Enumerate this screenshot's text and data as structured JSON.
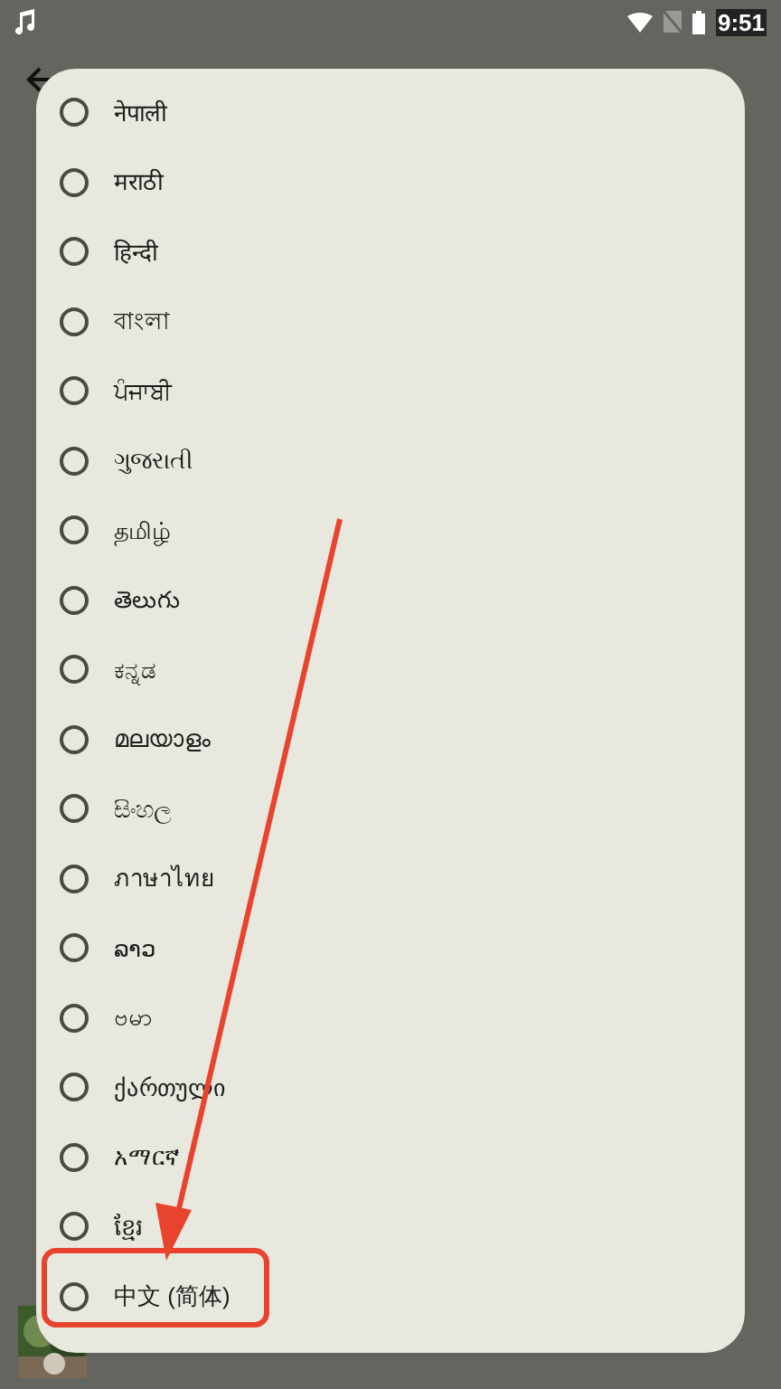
{
  "status_bar": {
    "time": "9:51"
  },
  "language_dialog": {
    "options": [
      {
        "label": "नेपाली",
        "selected": false
      },
      {
        "label": "मराठी",
        "selected": false
      },
      {
        "label": "हिन्दी",
        "selected": false
      },
      {
        "label": "বাংলা",
        "selected": false
      },
      {
        "label": "ਪੰਜਾਬੀ",
        "selected": false
      },
      {
        "label": "ગુજરાતી",
        "selected": false
      },
      {
        "label": "தமிழ்",
        "selected": false
      },
      {
        "label": "తెలుగు",
        "selected": false
      },
      {
        "label": "ಕನ್ನಡ",
        "selected": false
      },
      {
        "label": "മലയാളം",
        "selected": false
      },
      {
        "label": "සිංහල",
        "selected": false
      },
      {
        "label": "ภาษาไทย",
        "selected": false
      },
      {
        "label": "ລາວ",
        "selected": false
      },
      {
        "label": "ဗမာ",
        "selected": false
      },
      {
        "label": "ქართული",
        "selected": false
      },
      {
        "label": "አማርኛ",
        "selected": false
      },
      {
        "label": "ខ្មែរ",
        "selected": false
      },
      {
        "label": "中文 (简体)",
        "selected": false
      }
    ]
  }
}
